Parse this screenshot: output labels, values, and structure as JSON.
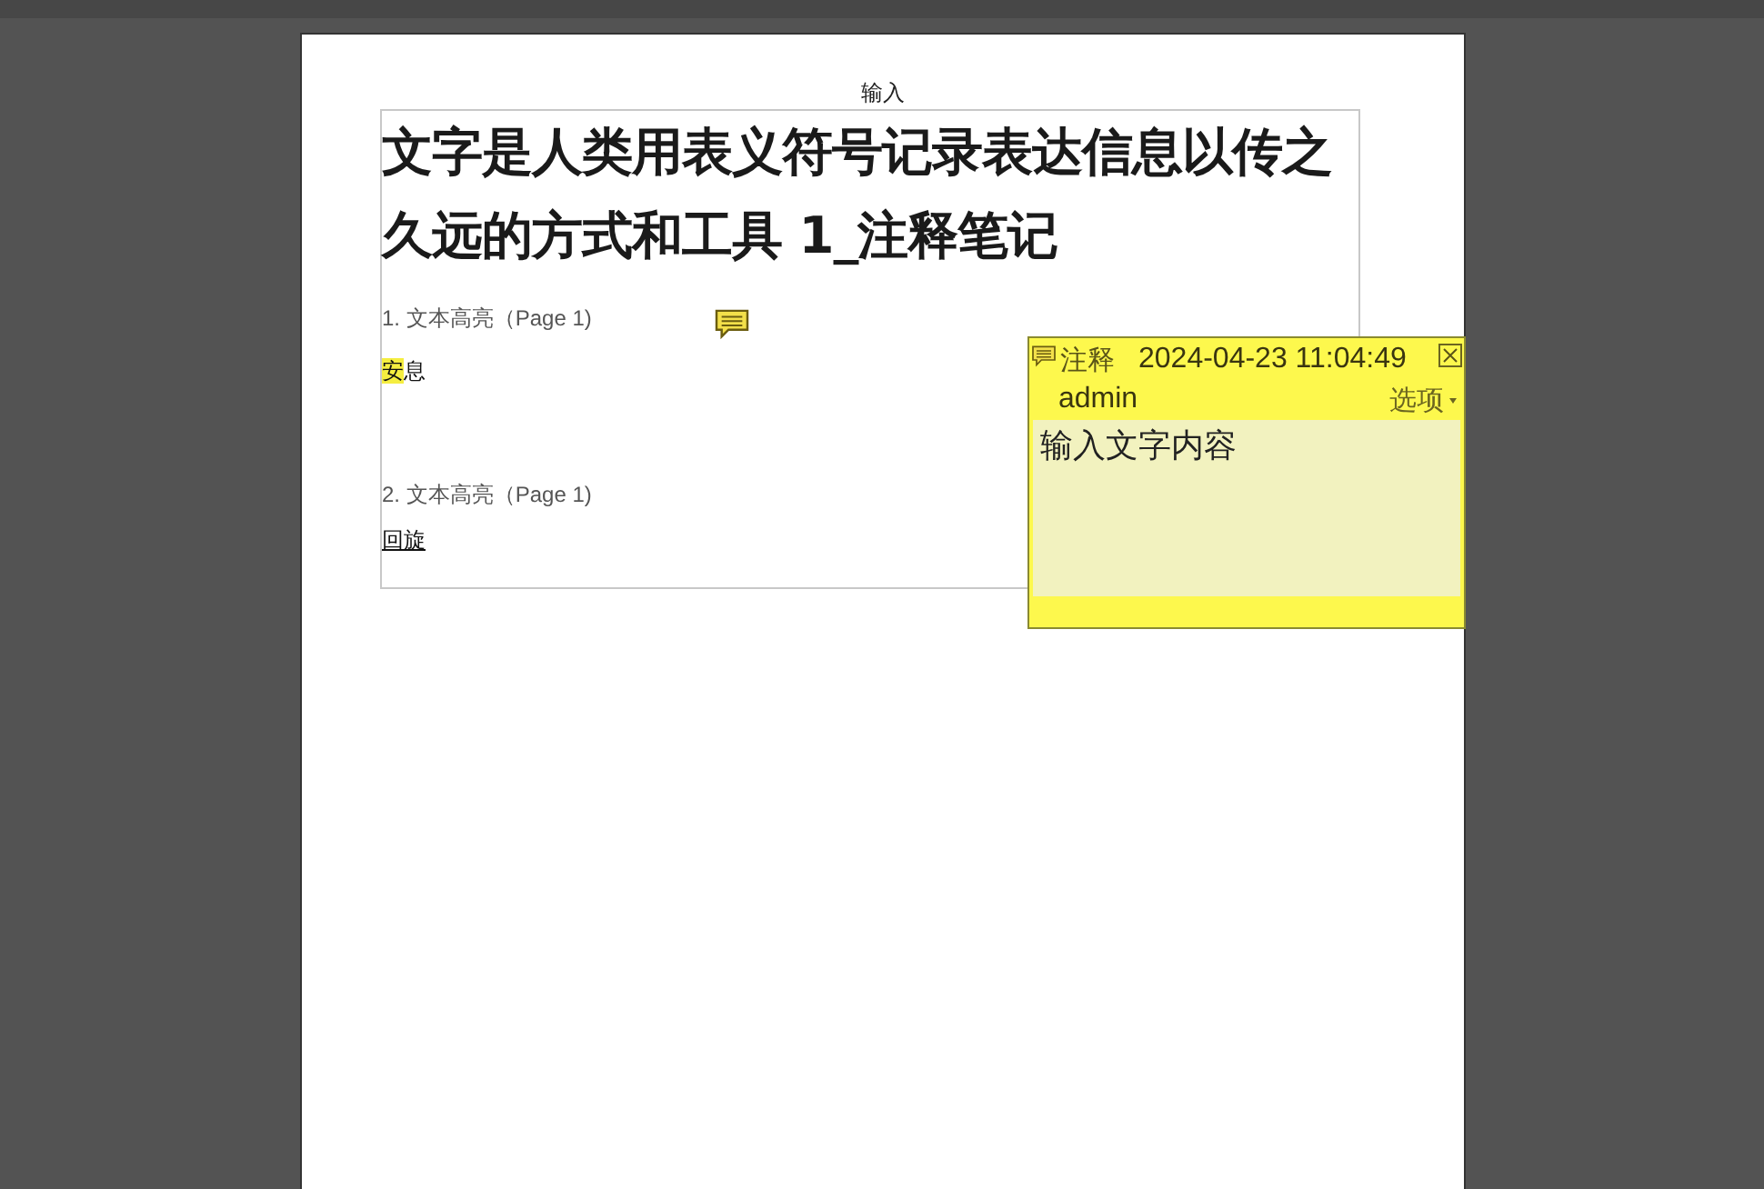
{
  "page": {
    "header": "输入",
    "title": "文字是人类用表义符号记录表达信息以传之久远的方式和工具 1_注释笔记",
    "annotations": [
      {
        "heading": "1. 文本高亮（Page 1)",
        "segments": [
          {
            "text": "安",
            "highlighted": true
          },
          {
            "text": "息",
            "highlighted": false
          }
        ],
        "has_note": true
      },
      {
        "heading": "2. 文本高亮（Page 1)",
        "segments": [
          {
            "text": "回旋",
            "highlighted": false
          }
        ],
        "has_note": false
      }
    ]
  },
  "note_popup": {
    "type": "注释",
    "timestamp": "2024-04-23 11:04:49",
    "author": "admin",
    "options": "选项",
    "content": "输入文字内容"
  }
}
